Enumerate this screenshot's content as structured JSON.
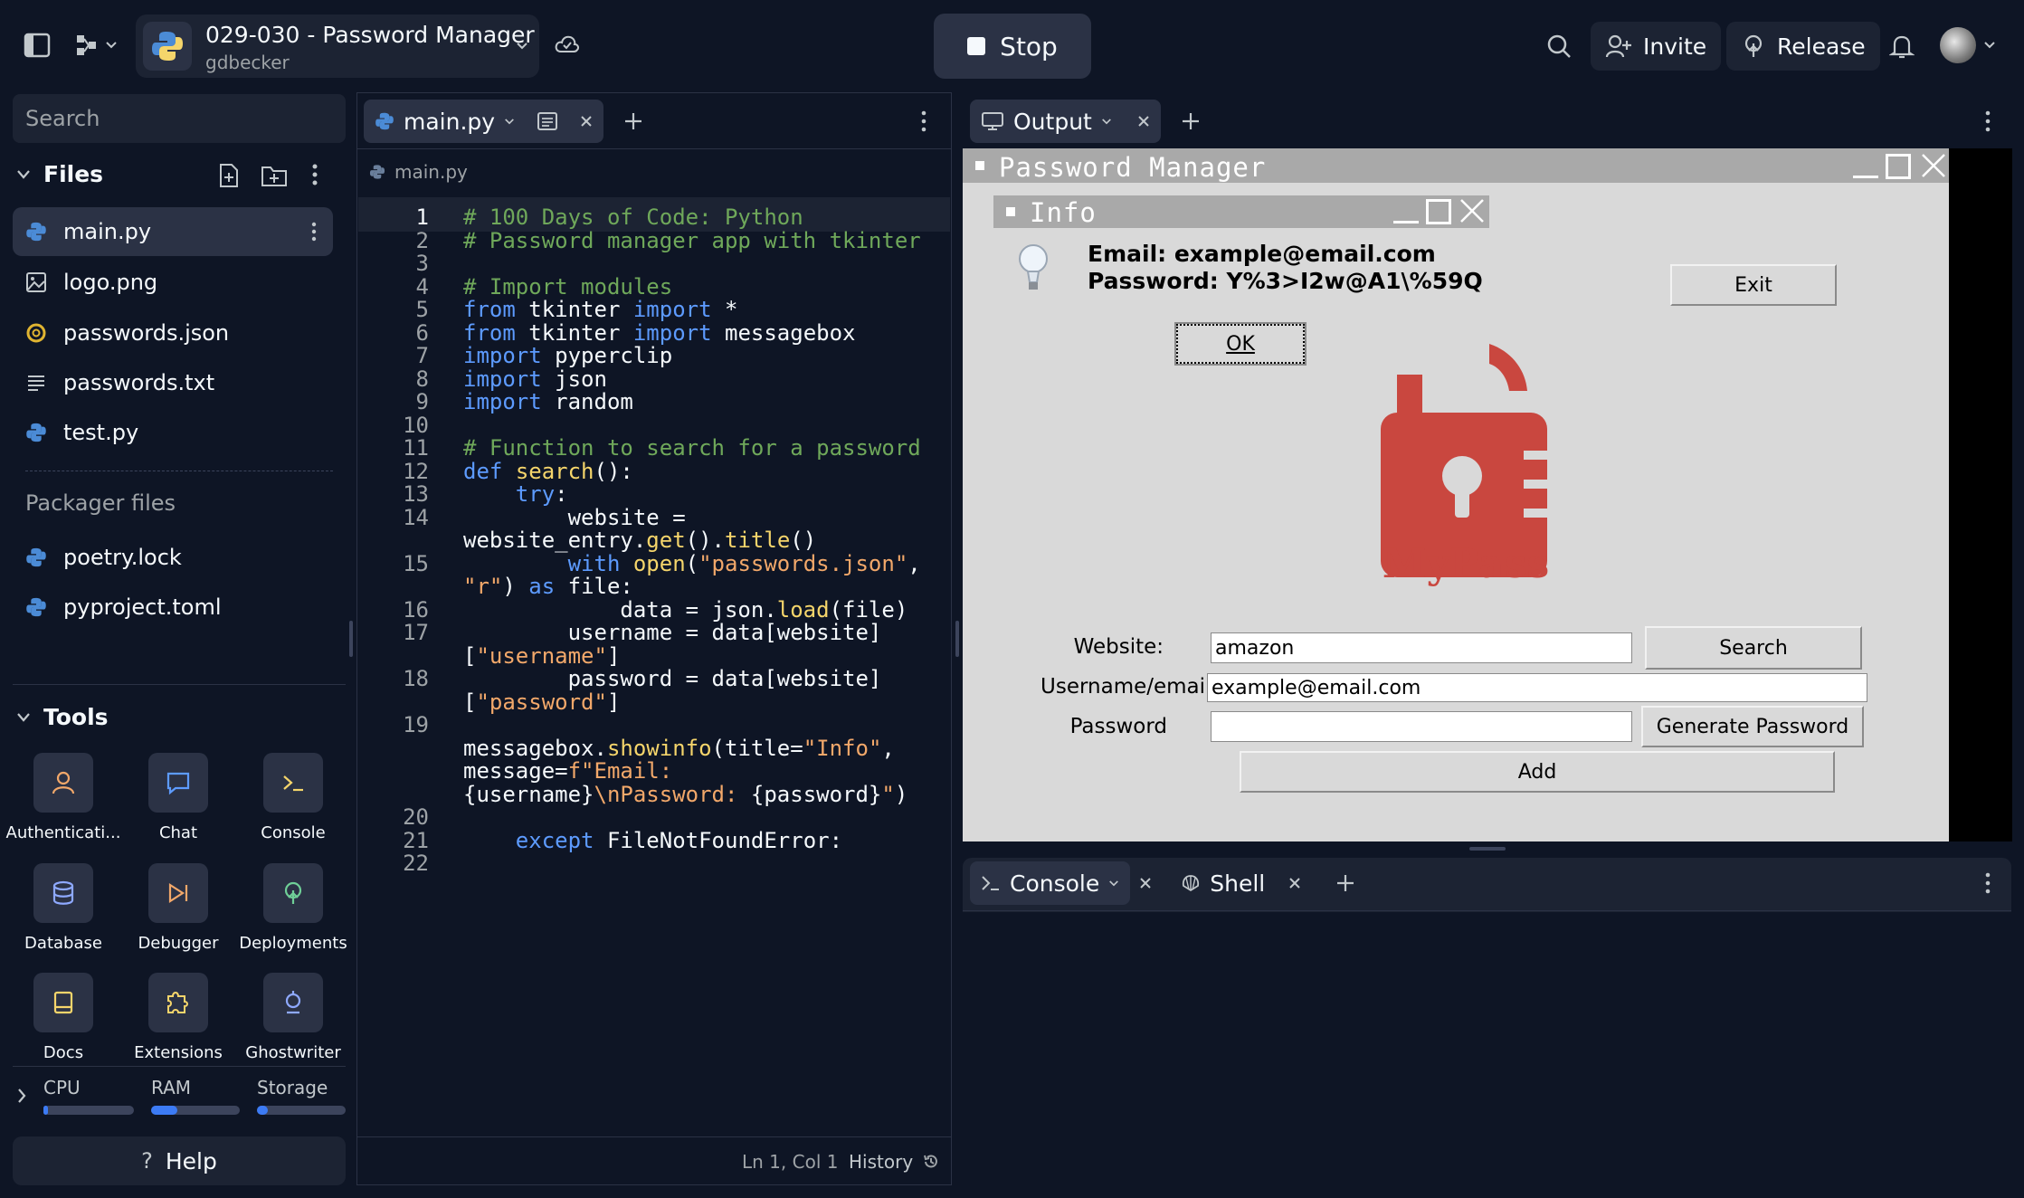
{
  "header": {
    "project_title": "029-030 - Password Manager",
    "project_user": "gdbecker",
    "stop_label": "Stop",
    "invite_label": "Invite",
    "release_label": "Release"
  },
  "sidebar": {
    "search_placeholder": "Search",
    "files_title": "Files",
    "files": [
      {
        "name": "main.py",
        "icon": "python-icon"
      },
      {
        "name": "logo.png",
        "icon": "image-icon"
      },
      {
        "name": "passwords.json",
        "icon": "json-icon"
      },
      {
        "name": "passwords.txt",
        "icon": "text-file-icon"
      },
      {
        "name": "test.py",
        "icon": "python-icon"
      }
    ],
    "packager_title": "Packager files",
    "packager_files": [
      {
        "name": "poetry.lock"
      },
      {
        "name": "pyproject.toml"
      }
    ],
    "tools_title": "Tools",
    "tools": [
      {
        "label": "Authenticati...",
        "icon": "user-icon"
      },
      {
        "label": "Chat",
        "icon": "chat-icon"
      },
      {
        "label": "Console",
        "icon": "terminal-icon"
      },
      {
        "label": "Database",
        "icon": "database-icon"
      },
      {
        "label": "Debugger",
        "icon": "debugger-icon"
      },
      {
        "label": "Deployments",
        "icon": "deploy-icon"
      },
      {
        "label": "Docs",
        "icon": "book-icon"
      },
      {
        "label": "Extensions",
        "icon": "puzzle-icon"
      },
      {
        "label": "Ghostwriter",
        "icon": "ghostwriter-icon"
      }
    ],
    "resources": [
      {
        "label": "CPU",
        "level": 0.05
      },
      {
        "label": "RAM",
        "level": 0.3
      },
      {
        "label": "Storage",
        "level": 0.12
      }
    ],
    "help_label": "Help"
  },
  "editor": {
    "tab_label": "main.py",
    "breadcrumb": "main.py",
    "lines": [
      {
        "n": "1",
        "segs": [
          [
            "c",
            "# 100 Days of Code: Python"
          ]
        ]
      },
      {
        "n": "2",
        "segs": [
          [
            "c",
            "# Password manager app with tkinter"
          ]
        ]
      },
      {
        "n": "3",
        "segs": []
      },
      {
        "n": "4",
        "segs": [
          [
            "c",
            "# Import modules"
          ]
        ]
      },
      {
        "n": "5",
        "segs": [
          [
            "k",
            "from"
          ],
          [
            "t",
            " tkinter "
          ],
          [
            "k",
            "import"
          ],
          [
            "t",
            " *"
          ]
        ]
      },
      {
        "n": "6",
        "segs": [
          [
            "k",
            "from"
          ],
          [
            "t",
            " tkinter "
          ],
          [
            "k",
            "import"
          ],
          [
            "t",
            " messagebox"
          ]
        ]
      },
      {
        "n": "7",
        "segs": [
          [
            "k",
            "import"
          ],
          [
            "t",
            " pyperclip"
          ]
        ]
      },
      {
        "n": "8",
        "segs": [
          [
            "k",
            "import"
          ],
          [
            "t",
            " json"
          ]
        ]
      },
      {
        "n": "9",
        "segs": [
          [
            "k",
            "import"
          ],
          [
            "t",
            " random"
          ]
        ]
      },
      {
        "n": "10",
        "segs": []
      },
      {
        "n": "11",
        "segs": [
          [
            "c",
            "# Function to search for a password"
          ]
        ]
      },
      {
        "n": "12",
        "segs": [
          [
            "k",
            "def"
          ],
          [
            "t",
            " "
          ],
          [
            "f",
            "search"
          ],
          [
            "t",
            "():"
          ]
        ]
      },
      {
        "n": "13",
        "segs": [
          [
            "t",
            "    "
          ],
          [
            "k",
            "try"
          ],
          [
            "t",
            ":"
          ]
        ]
      },
      {
        "n": "14",
        "segs": [
          [
            "t",
            "        website ="
          ]
        ]
      },
      {
        "n": "",
        "segs": [
          [
            "t",
            "website_entry."
          ],
          [
            "f",
            "get"
          ],
          [
            "t",
            "()."
          ],
          [
            "f",
            "title"
          ],
          [
            "t",
            "()"
          ]
        ]
      },
      {
        "n": "15",
        "segs": [
          [
            "t",
            "        "
          ],
          [
            "k",
            "with"
          ],
          [
            "t",
            " "
          ],
          [
            "f",
            "open"
          ],
          [
            "t",
            "("
          ],
          [
            "s",
            "\"passwords.json\""
          ],
          [
            "t",
            ","
          ]
        ]
      },
      {
        "n": "",
        "segs": [
          [
            "s",
            "\"r\""
          ],
          [
            "t",
            ") "
          ],
          [
            "k",
            "as"
          ],
          [
            "t",
            " file:"
          ]
        ]
      },
      {
        "n": "16",
        "segs": [
          [
            "t",
            "            data = json."
          ],
          [
            "f",
            "load"
          ],
          [
            "t",
            "(file)"
          ]
        ]
      },
      {
        "n": "17",
        "segs": [
          [
            "t",
            "        username = data[website]"
          ]
        ]
      },
      {
        "n": "",
        "segs": [
          [
            "t",
            "["
          ],
          [
            "s",
            "\"username\""
          ],
          [
            "t",
            "]"
          ]
        ]
      },
      {
        "n": "18",
        "segs": [
          [
            "t",
            "        password = data[website]"
          ]
        ]
      },
      {
        "n": "",
        "segs": [
          [
            "t",
            "["
          ],
          [
            "s",
            "\"password\""
          ],
          [
            "t",
            "]"
          ]
        ]
      },
      {
        "n": "19",
        "segs": []
      },
      {
        "n": "",
        "segs": [
          [
            "t",
            "messagebox."
          ],
          [
            "f",
            "showinfo"
          ],
          [
            "t",
            "(title="
          ],
          [
            "s",
            "\"Info\""
          ],
          [
            "t",
            ","
          ]
        ]
      },
      {
        "n": "",
        "segs": [
          [
            "t",
            "message="
          ],
          [
            "s",
            "f\"Email:"
          ]
        ]
      },
      {
        "n": "",
        "segs": [
          [
            "t",
            "{username}"
          ],
          [
            "s",
            "\\nPassword: "
          ],
          [
            "t",
            "{password}"
          ],
          [
            "s",
            "\""
          ],
          [
            "t",
            ")"
          ]
        ]
      },
      {
        "n": "20",
        "segs": []
      },
      {
        "n": "21",
        "segs": [
          [
            "t",
            "    "
          ],
          [
            "k",
            "except"
          ],
          [
            "t",
            " FileNotFoundError:"
          ]
        ]
      },
      {
        "n": "22",
        "segs": []
      }
    ],
    "cursor_pos": "Ln 1, Col 1",
    "history_label": "History"
  },
  "output": {
    "tab_label": "Output",
    "app_title": "Password Manager",
    "dialog_title": "Info",
    "dialog_line1": "Email: example@email.com",
    "dialog_line2": "Password: Y%3>I2w@A1\\%59Q",
    "ok_label": "OK",
    "exit_label": "Exit",
    "logo_text": "MyPass",
    "website_label": "Website:",
    "website_value": "amazon",
    "search_label": "Search",
    "username_label": "Username/email:",
    "username_value": "example@email.com",
    "password_label": "Password",
    "password_value": "",
    "generate_label": "Generate Password",
    "add_label": "Add",
    "logo_color": "#c9473f"
  },
  "console": {
    "tabs": [
      {
        "label": "Console"
      },
      {
        "label": "Shell"
      }
    ]
  }
}
